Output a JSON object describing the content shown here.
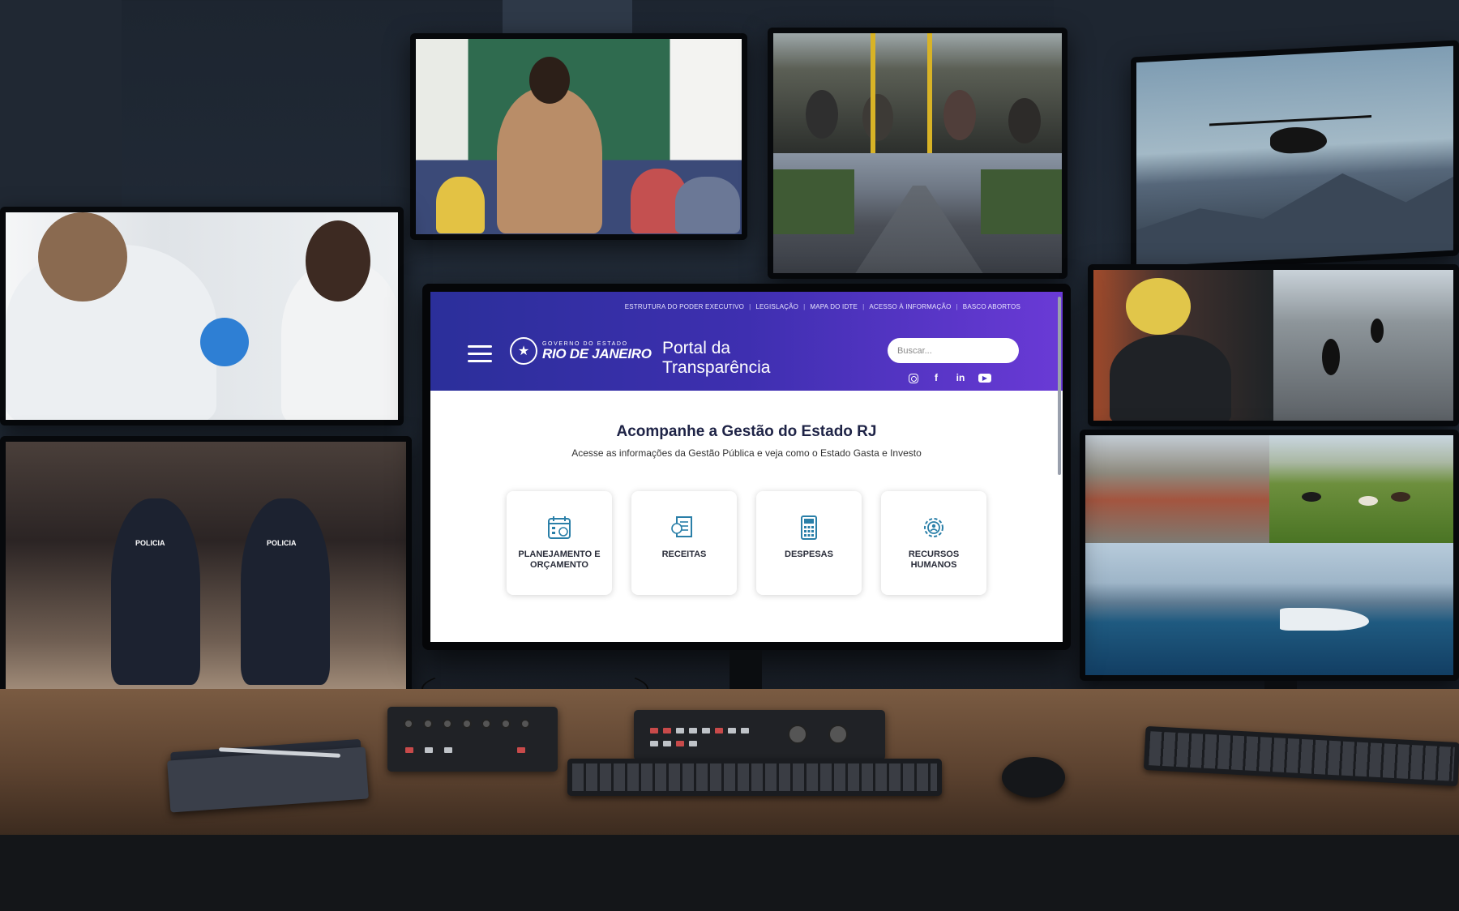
{
  "portal": {
    "top_links": [
      "ESTRUTURA DO PODER EXECUTIVO",
      "LEGISLAÇÃO",
      "MAPA DO IDTE",
      "ACESSO À INFORMAÇÃO",
      "BASCO ABORTOS"
    ],
    "gov_logo_line1": "GOVERNO DO ESTADO",
    "gov_logo_line2": "RIO DE JANEIRO",
    "title_line1": "Portal da",
    "title_line2": "Transparência",
    "search_placeholder": "Buscar...",
    "social_icons": [
      "instagram-icon",
      "facebook-icon",
      "linkedin-icon",
      "youtube-icon"
    ],
    "social_glyphs": {
      "facebook": "f",
      "linkedin": "in",
      "youtube": "▶"
    },
    "hero_title": "Acompanhe a Gestão do Estado RJ",
    "hero_subtitle": "Acesse as informações da Gestão Pública e veja como o Estado Gasta e Investo",
    "cards": [
      {
        "label": "PLANEJAMENTO E ORÇAMENTO",
        "icon": "calendar-money-icon"
      },
      {
        "label": "RECEITAS",
        "icon": "document-money-icon"
      },
      {
        "label": "DESPESAS",
        "icon": "calculator-icon"
      },
      {
        "label": "RECURSOS HUMANOS",
        "icon": "gear-people-icon"
      }
    ],
    "colors": {
      "header_start": "#2b2f9a",
      "header_end": "#6a3ad6",
      "icon_accent": "#2a7fa8",
      "title_text": "#1e2346"
    }
  },
  "surrounding_screens": {
    "police_badge_text": "POLICIA"
  }
}
